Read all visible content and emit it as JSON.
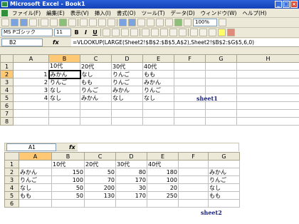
{
  "window": {
    "title": "Microsoft Excel - Book1",
    "buttons": [
      "_",
      "□",
      "×"
    ]
  },
  "menu": [
    "ファイル(F)",
    "編集(E)",
    "表示(V)",
    "挿入(I)",
    "書式(O)",
    "ツール(T)",
    "データ(D)",
    "ウィンドウ(W)",
    "ヘルプ(H)"
  ],
  "toolbar": {
    "zoom": "100%",
    "font_name": "MS Pゴシック",
    "font_size": "11",
    "bold": "B",
    "italic": "I",
    "underline": "U"
  },
  "formula_bar": {
    "cell_ref": "B2",
    "fx": "fx",
    "formula": "=VLOOKUP(LARGE(Sheet2!$B$2:$B$5,A$2),Sheet2!$B$2:$G$5,6,0)"
  },
  "sheet1": {
    "label": "sheet1",
    "columns": [
      "A",
      "B",
      "C",
      "D",
      "E",
      "F",
      "G",
      "H"
    ],
    "rows": [
      {
        "num": "1",
        "cells": [
          "",
          "10代",
          "20代",
          "30代",
          "40代",
          "",
          "",
          ""
        ]
      },
      {
        "num": "2",
        "cells": [
          "1",
          "みかん",
          "なし",
          "りんご",
          "もも",
          "",
          "",
          ""
        ]
      },
      {
        "num": "3",
        "cells": [
          "2",
          "りんご",
          "もも",
          "りんご",
          "みかん",
          "",
          "",
          ""
        ]
      },
      {
        "num": "4",
        "cells": [
          "3",
          "なし",
          "りんご",
          "みかん",
          "りんご",
          "",
          "",
          ""
        ]
      },
      {
        "num": "5",
        "cells": [
          "4",
          "なし",
          "みかん",
          "なし",
          "なし",
          "",
          "",
          ""
        ]
      },
      {
        "num": "6",
        "cells": [
          "",
          "",
          "",
          "",
          "",
          "",
          "",
          ""
        ]
      },
      {
        "num": "7",
        "cells": [
          "",
          "",
          "",
          "",
          "",
          "",
          "",
          ""
        ]
      },
      {
        "num": "8",
        "cells": [
          "",
          "",
          "",
          "",
          "",
          "",
          "",
          ""
        ]
      }
    ]
  },
  "sheet2": {
    "label": "sheet2",
    "cell_ref": "A1",
    "fx": "fx",
    "columns": [
      "A",
      "B",
      "C",
      "D",
      "E",
      "F",
      "G"
    ],
    "rows": [
      {
        "num": "1",
        "cells": [
          "",
          "10代",
          "20代",
          "30代",
          "40代",
          "",
          ""
        ]
      },
      {
        "num": "2",
        "cells": [
          "みかん",
          "150",
          "50",
          "80",
          "180",
          "",
          "みかん"
        ]
      },
      {
        "num": "3",
        "cells": [
          "りんご",
          "100",
          "70",
          "170",
          "100",
          "",
          "りんご"
        ]
      },
      {
        "num": "4",
        "cells": [
          "なし",
          "50",
          "200",
          "30",
          "20",
          "",
          "なし"
        ]
      },
      {
        "num": "5",
        "cells": [
          "もも",
          "50",
          "130",
          "170",
          "250",
          "",
          "もも"
        ]
      },
      {
        "num": "6",
        "cells": [
          "",
          "",
          "",
          "",
          "",
          "",
          ""
        ]
      }
    ]
  }
}
